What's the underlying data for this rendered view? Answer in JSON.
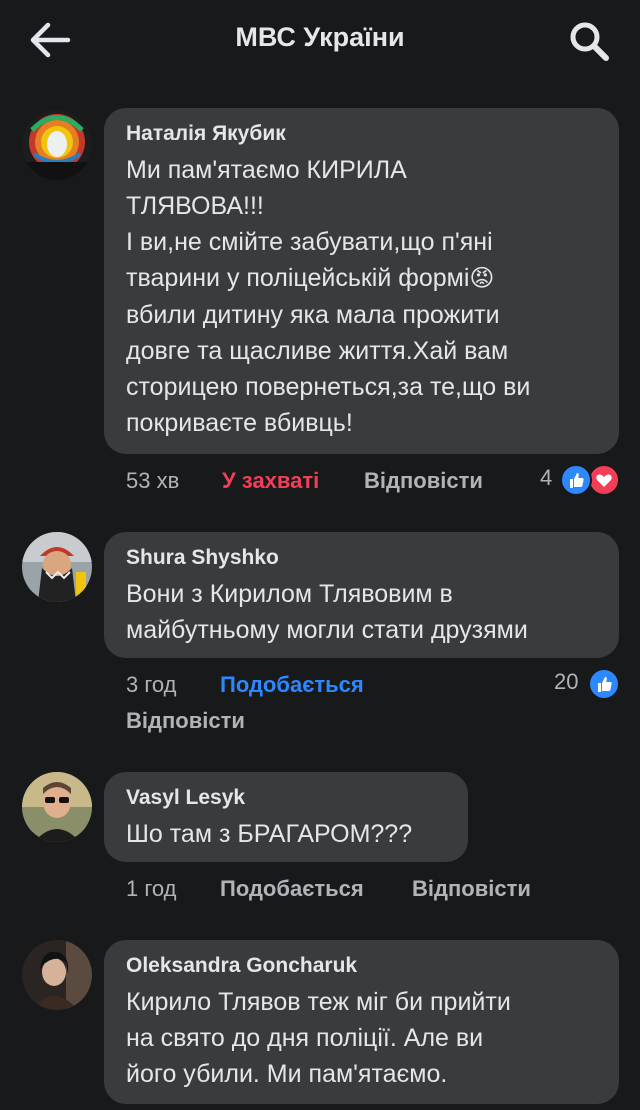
{
  "header": {
    "title": "МВС України"
  },
  "comments": [
    {
      "author": "Наталія Якубик",
      "lines": [
        "Ми пам'ятаємо КИРИЛА",
        "ТЛЯВОВА!!!",
        "І ви,не смійте забувати,що п'яні",
        "тварини у поліцейській формі",
        "вбили дитину яка мала прожити",
        "довге та щасливе життя.Хай вам",
        "сторицею повернеться,за те,що ви",
        "покриваєте вбивць!"
      ],
      "emoji": "😡",
      "time": "53 хв",
      "reaction_label": "У захваті",
      "reply_label": "Відповісти",
      "reaction_count": "4",
      "reaction_color": "#f33e58"
    },
    {
      "author": "Shura Shyshko",
      "lines": [
        "Вони з Кирилом Тлявовим в",
        "майбутньому могли стати друзями"
      ],
      "time": "3 год",
      "reaction_label": "Подобається",
      "reply_label": "Відповісти",
      "reaction_count": "20",
      "reaction_color": "#2d88ff"
    },
    {
      "author": "Vasyl Lesyk",
      "lines": [
        "Шо там з БРАГАРОМ???"
      ],
      "time": "1 год",
      "reaction_label": "Подобається",
      "reply_label": "Відповісти"
    },
    {
      "author": "Oleksandra Goncharuk",
      "lines": [
        "Кирило Тлявов теж міг би прийти",
        "на свято до дня поліції. Але ви",
        "його убили. Ми пам'ятаємо."
      ]
    }
  ],
  "icons": {
    "back": "arrow-left-icon",
    "search": "search-icon",
    "like": "thumbs-up-icon",
    "love": "heart-icon"
  },
  "colors": {
    "background": "#18191a",
    "bubble": "#3a3b3c",
    "text": "#e4e6eb",
    "muted": "#b0b3b8",
    "like_blue": "#2d88ff",
    "love_red": "#f33e58"
  }
}
